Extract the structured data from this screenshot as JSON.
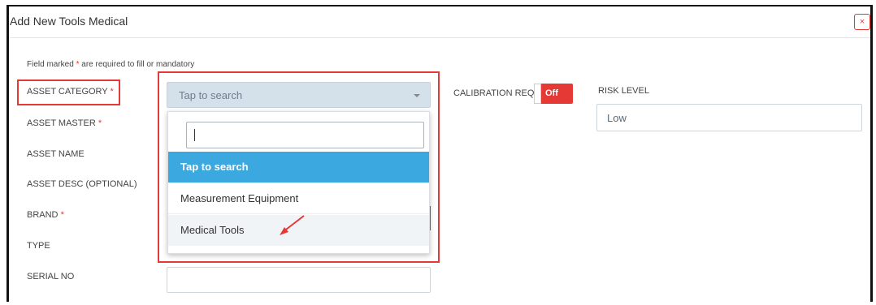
{
  "dialog": {
    "title": "Add New Tools Medical",
    "close_label": "×"
  },
  "form": {
    "required_note_prefix": "Field marked",
    "required_star": "*",
    "required_note_suffix": "are required to fill or mandatory",
    "labels": {
      "asset_category": "ASSET CATEGORY",
      "asset_master": "ASSET MASTER",
      "asset_name": "ASSET NAME",
      "asset_desc": "ASSET DESC (OPTIONAL)",
      "brand": "BRAND",
      "type": "TYPE",
      "serial_no": "SERIAL NO",
      "calibration_req": "CALIBRATION REQ",
      "risk_level": "RISK LEVEL"
    },
    "asset_category_placeholder": "Tap to search",
    "calibration_toggle": "Off",
    "risk_level_value": "Low"
  },
  "dropdown": {
    "search_value": "",
    "options": [
      "Tap to search",
      "Measurement Equipment",
      "Medical Tools"
    ]
  },
  "colors": {
    "accent_red": "#e53935",
    "option_active": "#3ba8e0",
    "select_bg": "#d4e0ea"
  }
}
